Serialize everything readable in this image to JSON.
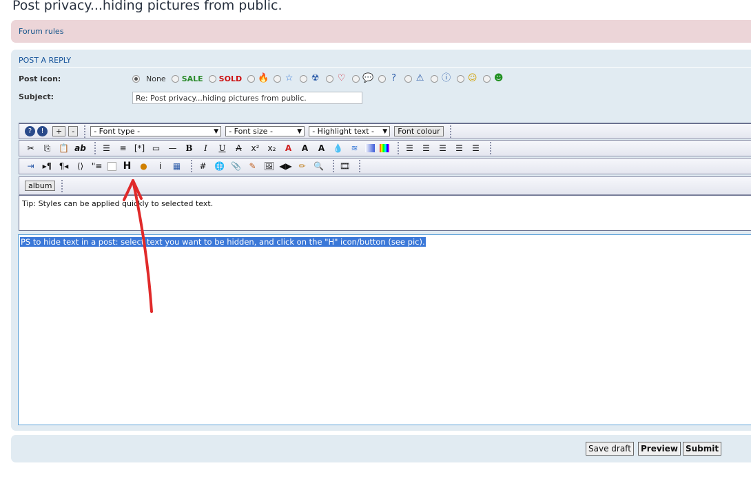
{
  "page_title": "Post privacy...hiding pictures from public.",
  "forum_rules": "Forum rules",
  "post_reply": {
    "heading": "POST A REPLY",
    "post_icon_label": "Post icon:",
    "subject_label": "Subject:",
    "icons": {
      "none": "None",
      "sale": "SALE",
      "sold": "SOLD"
    },
    "subject_value": "Re: Post privacy...hiding pictures from public."
  },
  "toolbar": {
    "plus": "+",
    "minus": "-",
    "font_type": "- Font type -",
    "font_size": "- Font size -",
    "highlight": "- Highlight text -",
    "font_colour": "Font colour",
    "album": "album"
  },
  "tip": "Tip: Styles can be applied quickly to selected text.",
  "editor_text": "PS to hide text in a post: select text you want to be hidden, and click on the \"H\" icon/button (see pic).",
  "buttons": {
    "save_draft": "Save draft",
    "preview": "Preview",
    "submit": "Submit"
  },
  "colors": {
    "sale": "#2a8a2a",
    "sold": "#cc1111",
    "arrow": "#e02a2a",
    "selection": "#3b78d8"
  }
}
